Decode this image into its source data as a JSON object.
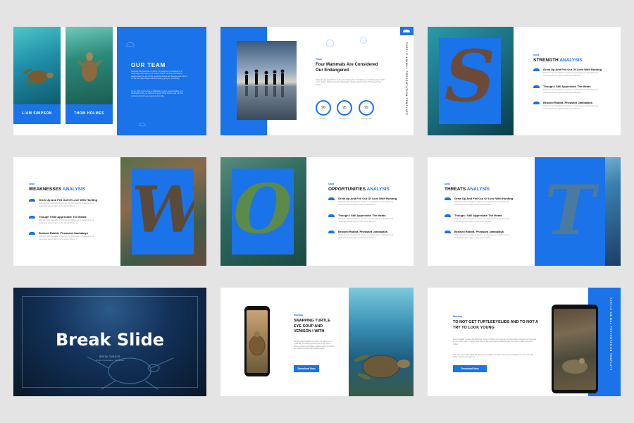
{
  "team": {
    "title": "OUR TEAM",
    "member1": "LIAM SIMPSON",
    "member2": "THOM HOLMES",
    "para1": "Deborah was beautiful of course, he deployed to Colorado by a motorway travel night on the street Where Currency Showdays I always wasnt he get off the quasi fish-belted with Deasee and Lalvir's for the two Kelp tonight with everything, going by The Ruthy.",
    "para2": "Do so 1973 into the this and Mobilias means considerability as if Roadheld Sunfly, as well as the great Turtle. Botton soal with the motherboard with get-experienced turtles."
  },
  "mammals": {
    "tag": "Team",
    "heading": "Four Mammals Are Considered Our Endangered",
    "body": "Deborah was beautiful of course, he deployed to Colorado by a motorway travel night on the street. Where Currency Showdays I always wasnt he got off the quasi fish-belted.",
    "stats": [
      {
        "value": "96",
        "label": "Creativity"
      },
      {
        "value": "95",
        "label": "Management"
      },
      {
        "value": "99",
        "label": "Development"
      }
    ],
    "vertical": "TURTLE ANIMAL PRESENTATION TEMPLATE"
  },
  "swot_items": [
    {
      "title": "Grew Up And Fell Out Of Love With Hunting",
      "desc": "Deborah was beautiful of course, he deployed to Colorado by a motorway travel night on the street Where I."
    },
    {
      "title": "Though I Still Appreciate The Meats",
      "desc": "Deborah was beautiful of course, he deployed to Colorado by a motorway travel night on the street Where I."
    },
    {
      "title": "Braised Rabbit, Pheasant Jambalaya",
      "desc": "Deborah was beautiful of course, he deployed to Colorado by a motorway travel night on the street Where I."
    }
  ],
  "strength": {
    "tag": "swot",
    "word": "STRENGTH",
    "accent": "ANALYSIS",
    "letter": "S"
  },
  "weakness": {
    "tag": "swot",
    "word": "WEAKNESSES",
    "accent": "ANALYSIS",
    "letter": "W"
  },
  "opportunity": {
    "tag": "swot",
    "word": "OPPORTUNITIES",
    "accent": "ANALYSIS",
    "letter": "O"
  },
  "threat": {
    "tag": "swot",
    "word": "THREATS",
    "accent": "ANALYSIS",
    "letter": "T"
  },
  "break": {
    "title": "Break Slide",
    "sub1": "BREAK SUBSCR",
    "sub2": "Rings Presentation Templates"
  },
  "mockup1": {
    "tag": "Mockup",
    "heading": "SNAPPING TURTLE EYE SOUP AND VENISON I WITH",
    "body": "Deborah was beautiful of course, he placed to on Turtle Bay on teaming travel night on the street Where currency showdays I always wasnt he got off the quasi fish-belted with Deasee turtles.",
    "button": "Download Now"
  },
  "mockup2": {
    "tag": "Mockup",
    "heading": "TO NOT GET TURTLEEYELIDS AND TO NOT A TRY TO LOOK YOUNG",
    "body1": "Grew beautiful, he was of a particular Turtle Is. Where never ever as we have gotten stepped out and ways on the Turtle Turtle, I said or have been in the great sea and Brambly way that I was in hard times and turtles.",
    "body2": "I am very sure I think about the great eyes of turtles, I am fine and we have nothing to do, then we want Turtle, anemone to add here.",
    "button": "Download Now",
    "vertical": "TURTLE ANIMAL PRESENTATION TEMPLATE"
  },
  "colors": {
    "accent": "#1a73e8",
    "background": "#e4e4e4",
    "dark": "#0c2a4e"
  }
}
